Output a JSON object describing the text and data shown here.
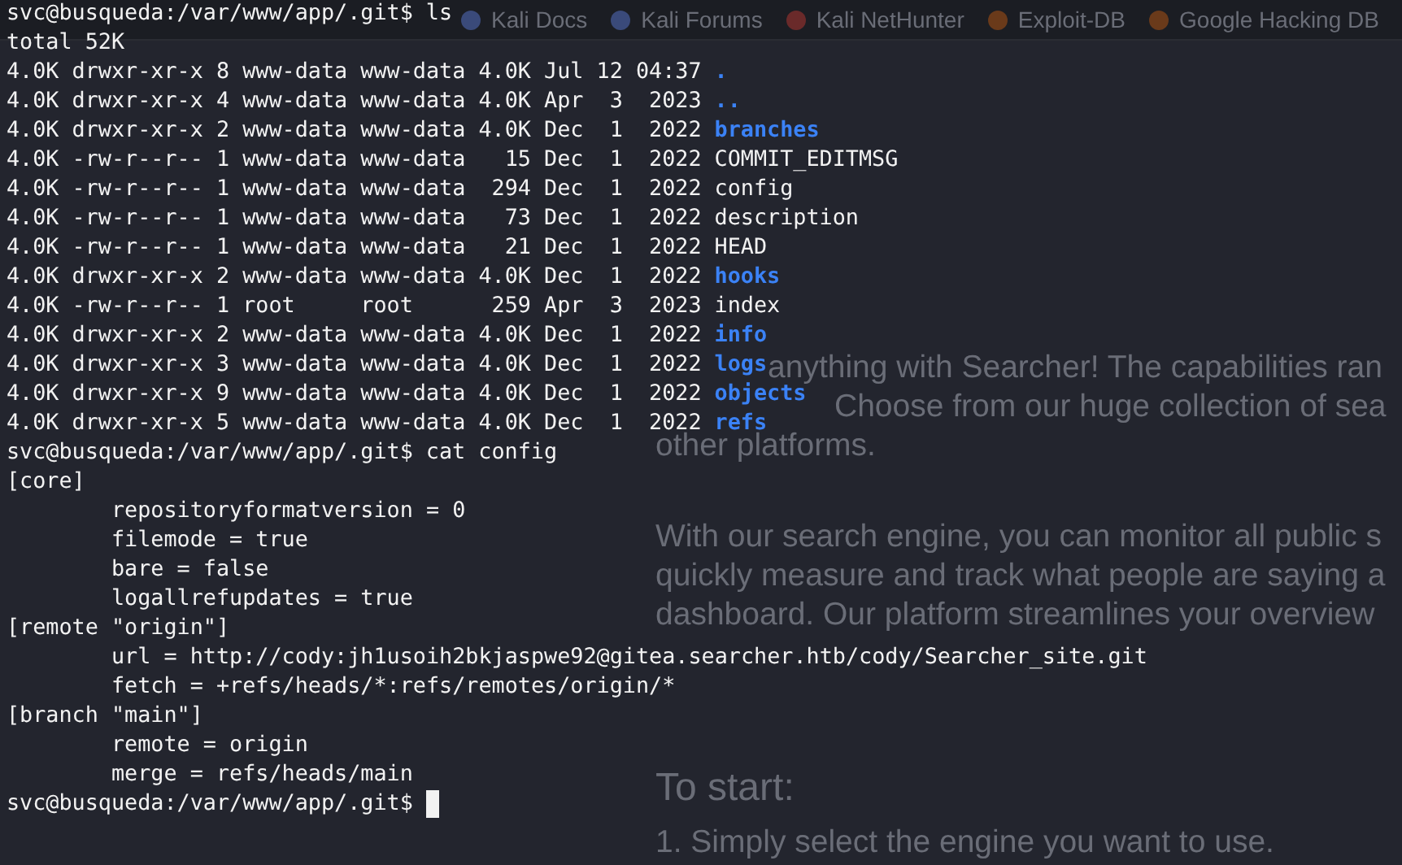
{
  "background_page": {
    "bookmarks": [
      "Kali Docs",
      "Kali Forums",
      "Kali NetHunter",
      "Exploit-DB",
      "Google Hacking DB"
    ],
    "intro_lines": [
      "anything with Searcher! The capabilities ran",
      "Choose from our huge collection of sea",
      "other platforms."
    ],
    "paragraph_lines": [
      "With our search engine, you can monitor all public s",
      "quickly measure and track what people are saying a",
      "dashboard. Our platform streamlines your overview"
    ],
    "heading": "To start:",
    "list_item": "1. Simply select the engine you want to use."
  },
  "terminal": {
    "lines": [
      {
        "kind": "prompt",
        "prompt": "svc@busqueda:/var/www/app/.git$",
        "command": "ls",
        "cursor": false
      },
      {
        "kind": "output",
        "text": "total 52K"
      },
      {
        "kind": "dir",
        "details": "4.0K drwxr-xr-x 8 www-data www-data 4.0K Jul 12 04:37",
        "name": "."
      },
      {
        "kind": "dir",
        "details": "4.0K drwxr-xr-x 4 www-data www-data 4.0K Apr  3  2023",
        "name": ".."
      },
      {
        "kind": "dir",
        "details": "4.0K drwxr-xr-x 2 www-data www-data 4.0K Dec  1  2022",
        "name": "branches"
      },
      {
        "kind": "file",
        "details": "4.0K -rw-r--r-- 1 www-data www-data   15 Dec  1  2022",
        "name": "COMMIT_EDITMSG"
      },
      {
        "kind": "file",
        "details": "4.0K -rw-r--r-- 1 www-data www-data  294 Dec  1  2022",
        "name": "config"
      },
      {
        "kind": "file",
        "details": "4.0K -rw-r--r-- 1 www-data www-data   73 Dec  1  2022",
        "name": "description"
      },
      {
        "kind": "file",
        "details": "4.0K -rw-r--r-- 1 www-data www-data   21 Dec  1  2022",
        "name": "HEAD"
      },
      {
        "kind": "dir",
        "details": "4.0K drwxr-xr-x 2 www-data www-data 4.0K Dec  1  2022",
        "name": "hooks"
      },
      {
        "kind": "file",
        "details": "4.0K -rw-r--r-- 1 root     root      259 Apr  3  2023",
        "name": "index"
      },
      {
        "kind": "dir",
        "details": "4.0K drwxr-xr-x 2 www-data www-data 4.0K Dec  1  2022",
        "name": "info"
      },
      {
        "kind": "dir",
        "details": "4.0K drwxr-xr-x 3 www-data www-data 4.0K Dec  1  2022",
        "name": "logs"
      },
      {
        "kind": "dir",
        "details": "4.0K drwxr-xr-x 9 www-data www-data 4.0K Dec  1  2022",
        "name": "objects"
      },
      {
        "kind": "dir",
        "details": "4.0K drwxr-xr-x 5 www-data www-data 4.0K Dec  1  2022",
        "name": "refs"
      },
      {
        "kind": "prompt",
        "prompt": "svc@busqueda:/var/www/app/.git$",
        "command": "cat config",
        "cursor": false
      },
      {
        "kind": "output",
        "text": "[core]"
      },
      {
        "kind": "output",
        "text": "\trepositoryformatversion = 0"
      },
      {
        "kind": "output",
        "text": "\tfilemode = true"
      },
      {
        "kind": "output",
        "text": "\tbare = false"
      },
      {
        "kind": "output",
        "text": "\tlogallrefupdates = true"
      },
      {
        "kind": "output",
        "text": "[remote \"origin\"]"
      },
      {
        "kind": "output",
        "text": "\turl = http://cody:jh1usoih2bkjaspwe92@gitea.searcher.htb/cody/Searcher_site.git"
      },
      {
        "kind": "output",
        "text": "\tfetch = +refs/heads/*:refs/remotes/origin/*"
      },
      {
        "kind": "output",
        "text": "[branch \"main\"]"
      },
      {
        "kind": "output",
        "text": "\tremote = origin"
      },
      {
        "kind": "output",
        "text": "\tmerge = refs/heads/main"
      },
      {
        "kind": "prompt",
        "prompt": "svc@busqueda:/var/www/app/.git$",
        "cursor": true
      }
    ]
  }
}
